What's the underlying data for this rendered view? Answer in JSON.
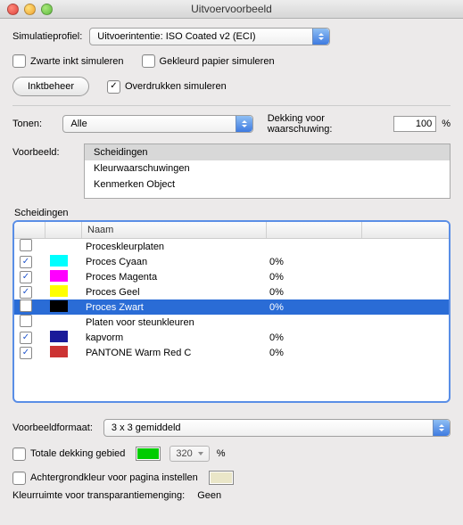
{
  "window": {
    "title": "Uitvoervoorbeeld"
  },
  "simprofile": {
    "label": "Simulatieprofiel:",
    "value": "Uitvoerintentie: ISO Coated v2 (ECI)"
  },
  "checks": {
    "simulate_black_ink": "Zwarte inkt simuleren",
    "simulate_paper": "Gekleurd papier simuleren",
    "simulate_overprint": "Overdrukken simuleren"
  },
  "buttons": {
    "ink_manager": "Inktbeheer"
  },
  "show": {
    "label": "Tonen:",
    "value": "Alle"
  },
  "warn": {
    "label": "Dekking voor waarschuwing:",
    "value": "100",
    "unit": "%"
  },
  "preview": {
    "label": "Voorbeeld:",
    "items": [
      "Scheidingen",
      "Kleurwaarschuwingen",
      "Kenmerken Object"
    ],
    "selected": 0
  },
  "seps": {
    "group_label": "Scheidingen",
    "header_name": "Naam",
    "rows": [
      {
        "checked": false,
        "color": "",
        "name": "Proceskleurplaten",
        "pct": ""
      },
      {
        "checked": true,
        "color": "#00ffff",
        "name": "Proces Cyaan",
        "pct": "0%"
      },
      {
        "checked": true,
        "color": "#ff00ff",
        "name": "Proces Magenta",
        "pct": "0%"
      },
      {
        "checked": true,
        "color": "#ffff00",
        "name": "Proces Geel",
        "pct": "0%"
      },
      {
        "checked": false,
        "color": "#000000",
        "name": "Proces Zwart",
        "pct": "0%",
        "selected": true
      },
      {
        "checked": false,
        "color": "",
        "name": "Platen voor steunkleuren",
        "pct": ""
      },
      {
        "checked": true,
        "color": "#1a1a99",
        "name": "kapvorm",
        "pct": "0%"
      },
      {
        "checked": true,
        "color": "#cc3333",
        "name": "PANTONE Warm Red C",
        "pct": "0%"
      }
    ]
  },
  "preview_format": {
    "label": "Voorbeeldformaat:",
    "value": "3 x 3 gemiddeld"
  },
  "total_area": {
    "label": "Totale dekking gebied",
    "color": "#00cc00",
    "value": "320",
    "unit": "%"
  },
  "page_bg": {
    "label": "Achtergrondkleur voor pagina instellen",
    "color": "#eae6c8"
  },
  "transparency": {
    "label": "Kleurruimte voor transparantiemenging:",
    "value": "Geen"
  }
}
